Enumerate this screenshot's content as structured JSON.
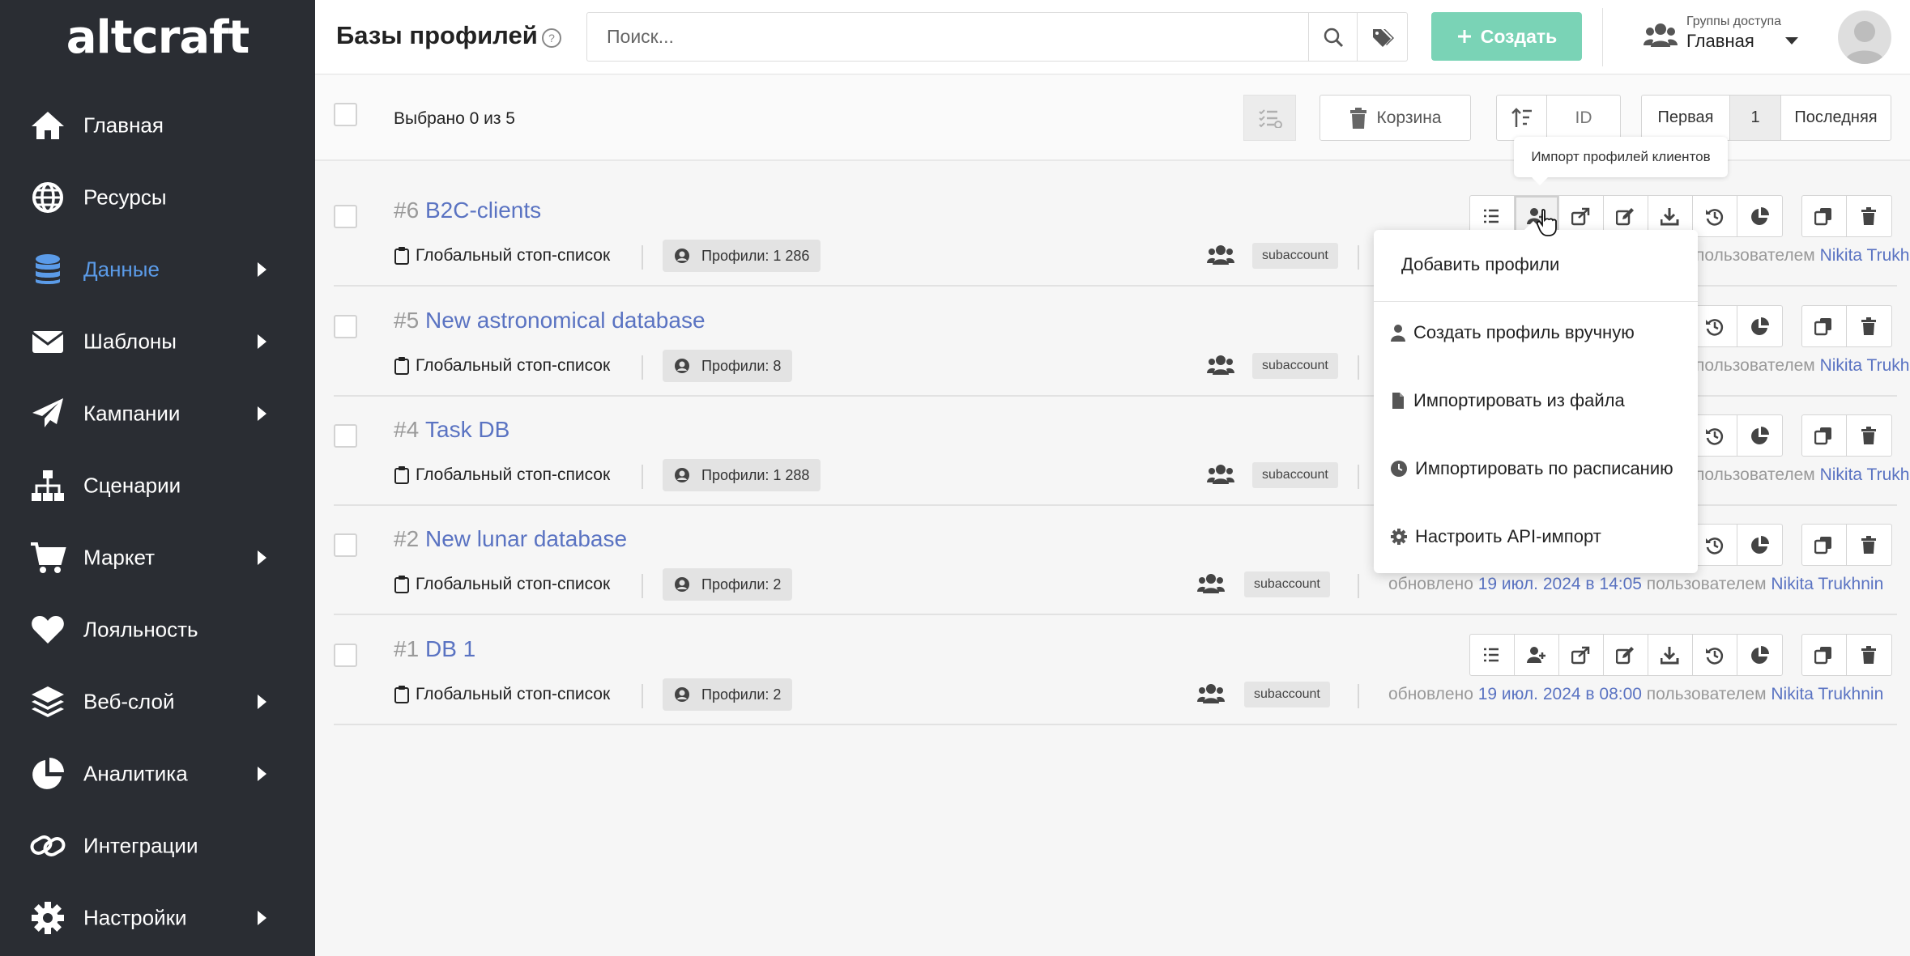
{
  "logo": "altcraft",
  "sidebar": {
    "items": [
      {
        "label": "Главная",
        "icon": "home-icon",
        "arrow": false
      },
      {
        "label": "Ресурсы",
        "icon": "globe-icon",
        "arrow": false
      },
      {
        "label": "Данные",
        "icon": "database-icon",
        "arrow": true,
        "active": true
      },
      {
        "label": "Шаблоны",
        "icon": "envelope-icon",
        "arrow": true
      },
      {
        "label": "Кампании",
        "icon": "paper-plane-icon",
        "arrow": true
      },
      {
        "label": "Сценарии",
        "icon": "sitemap-icon",
        "arrow": false
      },
      {
        "label": "Маркет",
        "icon": "cart-icon",
        "arrow": true
      },
      {
        "label": "Лояльность",
        "icon": "heart-icon",
        "arrow": false
      },
      {
        "label": "Веб-слой",
        "icon": "layers-icon",
        "arrow": true
      },
      {
        "label": "Аналитика",
        "icon": "pie-chart-icon",
        "arrow": true
      },
      {
        "label": "Интеграции",
        "icon": "link-icon",
        "arrow": false
      },
      {
        "label": "Настройки",
        "icon": "gear-icon",
        "arrow": true
      }
    ]
  },
  "header": {
    "title": "Базы профилей",
    "search_placeholder": "Поиск...",
    "create_label": "Создать",
    "groups_caption": "Группы доступа",
    "groups_value": "Главная"
  },
  "toolbar": {
    "selected_text": "Выбрано 0 из 5",
    "trash_label": "Корзина",
    "sort_id_label": "ID",
    "first_label": "Первая",
    "page_number": "1",
    "last_label": "Последняя"
  },
  "rows": [
    {
      "num": "#6",
      "name": "B2C-clients",
      "stoplist": "Глобальный стоп-список",
      "profiles": "Профили: 1 286",
      "subaccount": "subaccount",
      "updated_prefix": "",
      "updated_date": "",
      "updated_by_label": "пользователем",
      "user": "Nikita Trukhnin"
    },
    {
      "num": "#5",
      "name": "New astronomical database",
      "stoplist": "Глобальный стоп-список",
      "profiles": "Профили: 8",
      "subaccount": "subaccount",
      "updated_prefix": "",
      "updated_date": "",
      "updated_by_label": "пользователем",
      "user": "Nikita Trukhnin"
    },
    {
      "num": "#4",
      "name": "Task DB",
      "stoplist": "Глобальный стоп-список",
      "profiles": "Профили: 1 288",
      "subaccount": "subaccount",
      "updated_prefix": "",
      "updated_date": "",
      "updated_by_label": "пользователем",
      "user": "Nikita Trukhnin"
    },
    {
      "num": "#2",
      "name": "New lunar database",
      "stoplist": "Глобальный стоп-список",
      "profiles": "Профили: 2",
      "subaccount": "subaccount",
      "updated_prefix": "обновлено",
      "updated_date": "19 июл. 2024 в 14:05",
      "updated_by_label": "пользователем",
      "user": "Nikita Trukhnin"
    },
    {
      "num": "#1",
      "name": "DB 1",
      "stoplist": "Глобальный стоп-список",
      "profiles": "Профили: 2",
      "subaccount": "subaccount",
      "updated_prefix": "обновлено",
      "updated_date": "19 июл. 2024 в 08:00",
      "updated_by_label": "пользователем",
      "user": "Nikita Trukhnin"
    }
  ],
  "tooltip": "Импорт профилей клиентов",
  "dropdown": {
    "header": "Добавить профили",
    "items": [
      {
        "label": "Создать профиль вручную",
        "icon": "user-icon"
      },
      {
        "label": "Импортировать из файла",
        "icon": "file-icon"
      },
      {
        "label": "Импортировать по расписанию",
        "icon": "clock-icon"
      },
      {
        "label": "Настроить API-импорт",
        "icon": "gear-icon"
      }
    ]
  },
  "colors": {
    "sidebar_bg": "#2a2d33",
    "accent": "#5b9be8",
    "create": "#7ad3b6",
    "link": "#5a73c2"
  }
}
